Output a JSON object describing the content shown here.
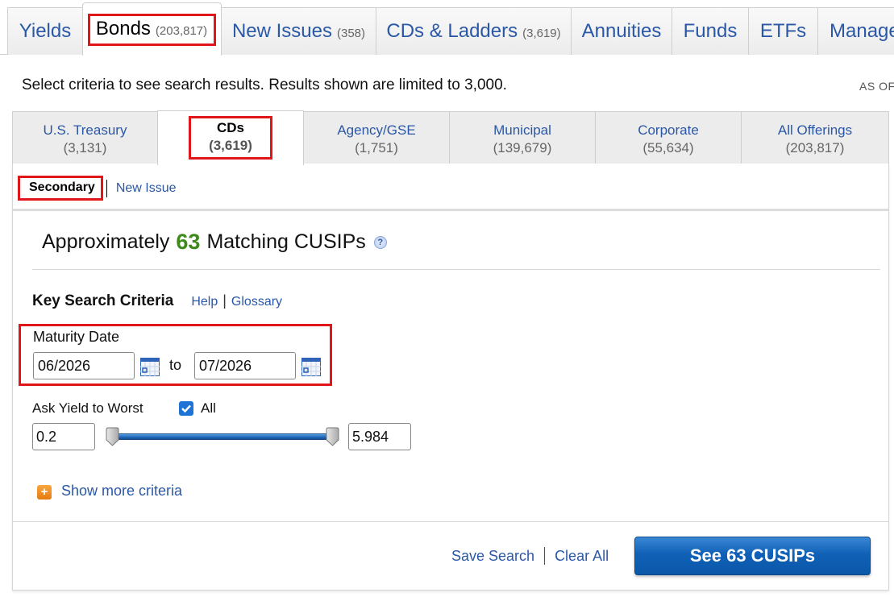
{
  "top_tabs": [
    {
      "label": "Yields",
      "count": ""
    },
    {
      "label": "Bonds",
      "count": "(203,817)",
      "active": true
    },
    {
      "label": "New Issues",
      "count": "(358)"
    },
    {
      "label": "CDs & Ladders",
      "count": "(3,619)"
    },
    {
      "label": "Annuities",
      "count": ""
    },
    {
      "label": "Funds",
      "count": ""
    },
    {
      "label": "ETFs",
      "count": ""
    },
    {
      "label": "Manage",
      "count": ""
    }
  ],
  "criteria_note": "Select criteria to see search results. Results shown are limited to 3,000.",
  "as_of": "AS OF",
  "sub_tabs": [
    {
      "label": "U.S. Treasury",
      "count": "(3,131)"
    },
    {
      "label": "CDs",
      "count": "(3,619)",
      "active": true
    },
    {
      "label": "Agency/GSE",
      "count": "(1,751)"
    },
    {
      "label": "Municipal",
      "count": "(139,679)"
    },
    {
      "label": "Corporate",
      "count": "(55,634)"
    },
    {
      "label": "All Offerings",
      "count": "(203,817)"
    }
  ],
  "issue_type": {
    "secondary": "Secondary",
    "new_issue": "New Issue",
    "selected": "Secondary"
  },
  "matching": {
    "prefix": "Approximately",
    "count": "63",
    "suffix": "Matching CUSIPs",
    "help_icon": "?"
  },
  "key_criteria": {
    "title": "Key Search Criteria",
    "help": "Help",
    "glossary": "Glossary"
  },
  "maturity": {
    "label": "Maturity Date",
    "from": "06/2026",
    "to_label": "to",
    "to": "07/2026"
  },
  "yield": {
    "label": "Ask Yield to Worst",
    "all_label": "All",
    "all_checked": true,
    "min": "0.2",
    "max": "5.984",
    "range_low_pct": 0,
    "range_high_pct": 100
  },
  "show_more": "Show more criteria",
  "footer": {
    "save_search": "Save Search",
    "clear_all": "Clear All",
    "see_button": "See 63 CUSIPs"
  },
  "colors": {
    "link": "#2b57a7",
    "highlight": "#e0161b",
    "count_green": "#3d8a1b",
    "button": "#0f61b7"
  }
}
